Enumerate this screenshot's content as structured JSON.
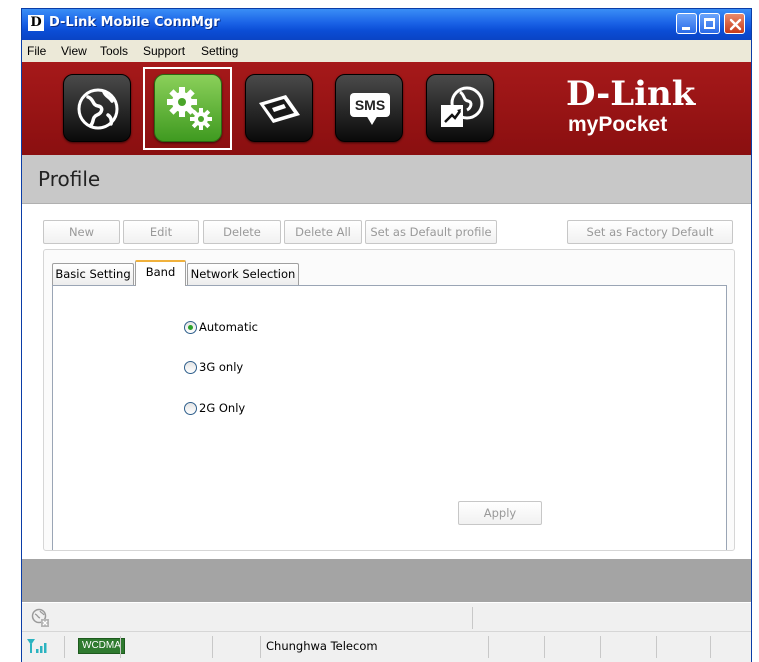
{
  "window": {
    "title": "D-Link Mobile ConnMgr",
    "logo_letter": "D"
  },
  "menu": [
    "File",
    "View",
    "Tools",
    "Support",
    "Setting"
  ],
  "nav": {
    "items": [
      {
        "name": "internet-icon",
        "active": false
      },
      {
        "name": "settings-icon",
        "active": true
      },
      {
        "name": "contacts-icon",
        "active": false
      },
      {
        "name": "sms-icon",
        "active": false,
        "label": "SMS"
      },
      {
        "name": "statistics-icon",
        "active": false
      }
    ],
    "brand_name": "D-Link",
    "brand_sub": "myPocket"
  },
  "profile": {
    "title": "Profile",
    "buttons": {
      "new": "New",
      "edit": "Edit",
      "delete": "Delete",
      "delete_all": "Delete All",
      "set_default": "Set as Default profile",
      "factory_default": "Set as Factory Default"
    }
  },
  "tabs": [
    {
      "label": "Basic Setting",
      "active": false
    },
    {
      "label": "Band",
      "active": true
    },
    {
      "label": "Network Selection",
      "active": false
    }
  ],
  "band": {
    "options": [
      {
        "label": "Automatic",
        "checked": true
      },
      {
        "label": "3G only",
        "checked": false
      },
      {
        "label": "2G Only",
        "checked": false
      }
    ],
    "apply": "Apply"
  },
  "status": {
    "network_type": "WCDMA",
    "carrier": "Chunghwa Telecom",
    "colors": {
      "accent": "#a6191a",
      "active_tab": "#f0b13c",
      "active_nav": "#5fb238",
      "signal": "#2bb3c0"
    }
  }
}
